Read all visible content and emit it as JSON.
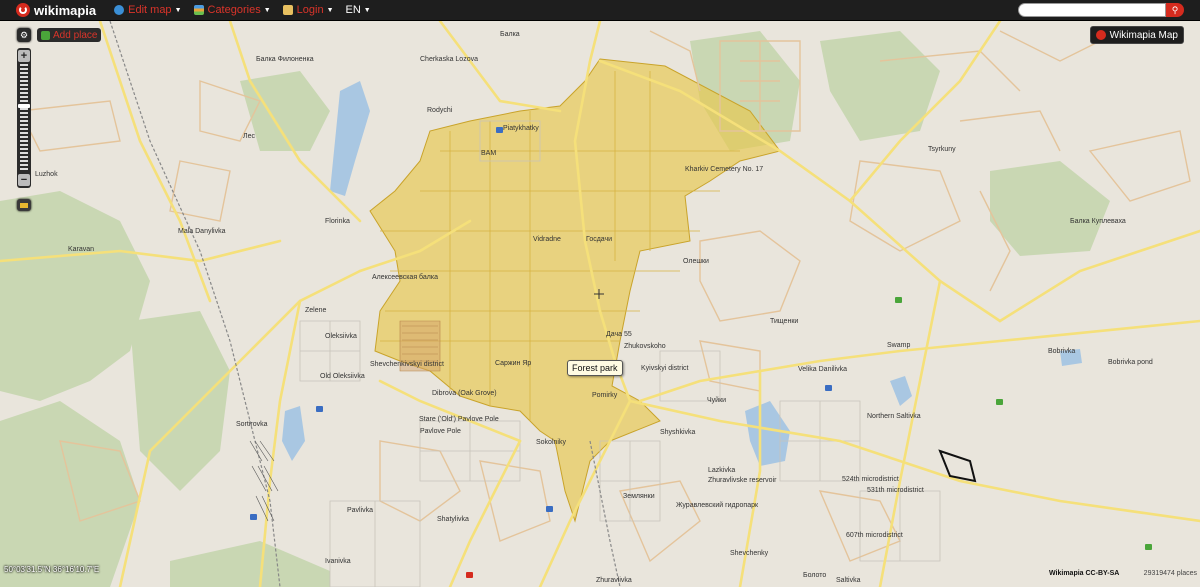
{
  "topbar": {
    "brand": "wikimapia",
    "menu": [
      {
        "label": "Edit map",
        "icon": "globe-icon",
        "color": "#d9342a"
      },
      {
        "label": "Categories",
        "icon": "categories-icon",
        "color": "#d9342a"
      },
      {
        "label": "Login",
        "icon": "login-icon",
        "color": "#d9342a"
      },
      {
        "label": "EN",
        "icon": "",
        "color": "#ffffff"
      }
    ],
    "search": {
      "value": "",
      "placeholder": ""
    }
  },
  "controls": {
    "add_place": "Add place",
    "zoom_in": "+",
    "zoom_out": "−",
    "zoom_level_fraction": 0.62,
    "map_type_badge": "Wikimapia Map"
  },
  "tooltip": "Forest park",
  "status": {
    "coordinates": "50°03'31.5\"N 36°16'10.7\"E",
    "copyright": "Wikimapia CC-BY-SA",
    "place_count": "29319474 places"
  },
  "labels": [
    "Балка Филоненка",
    "Cherkaska Lozova",
    "Балка",
    "Rodychi",
    "Piatykhatky",
    "BAM",
    "Лес",
    "Luzhok",
    "Florinka",
    "Mala Danylivka",
    "Karavan",
    "Алексеевская балка",
    "Vidradne",
    "Госдачи",
    "Kharkiv Cemetery No. 17",
    "Tsyrkuny",
    "Балка Куплеваха",
    "Олешки",
    "Zelene",
    "Oleksiivka",
    "Дача 55",
    "Zhukovskoho",
    "Тищенки",
    "Swamp",
    "Bobrivka",
    "Shevchenkivskyi district",
    "Саржин Яр",
    "Kyivskyi district",
    "Velika Danilivka",
    "Bobrivka pond",
    "Old Oleksiivka",
    "Dibrova (Oak Grove)",
    "Pomirky",
    "Чуйки",
    "Stare ('Old') Pavlove Pole",
    "Pavlove Pole",
    "Northern Saltivka",
    "Sortirovka",
    "Sokolniky",
    "Shyshkivka",
    "Lazkivka",
    "Zhuravlivske reservoir",
    "524th microdistrict",
    "531th microdistrict",
    "Землянки",
    "Журавлевский гидропарк",
    "Pavlivka",
    "Shatylivka",
    "607th microdistrict",
    "Ivanivka",
    "Shevchenky",
    "Zhuravlivka",
    "Болото",
    "Saltivka"
  ],
  "colors": {
    "land": "#e9e5dc",
    "road_major": "#f5e07a",
    "road_minor": "#e4c49b",
    "forest_area": "#e8c74d",
    "green": "#c9d7b3",
    "water": "#a9c7e2",
    "brand": "#d52b1e"
  }
}
